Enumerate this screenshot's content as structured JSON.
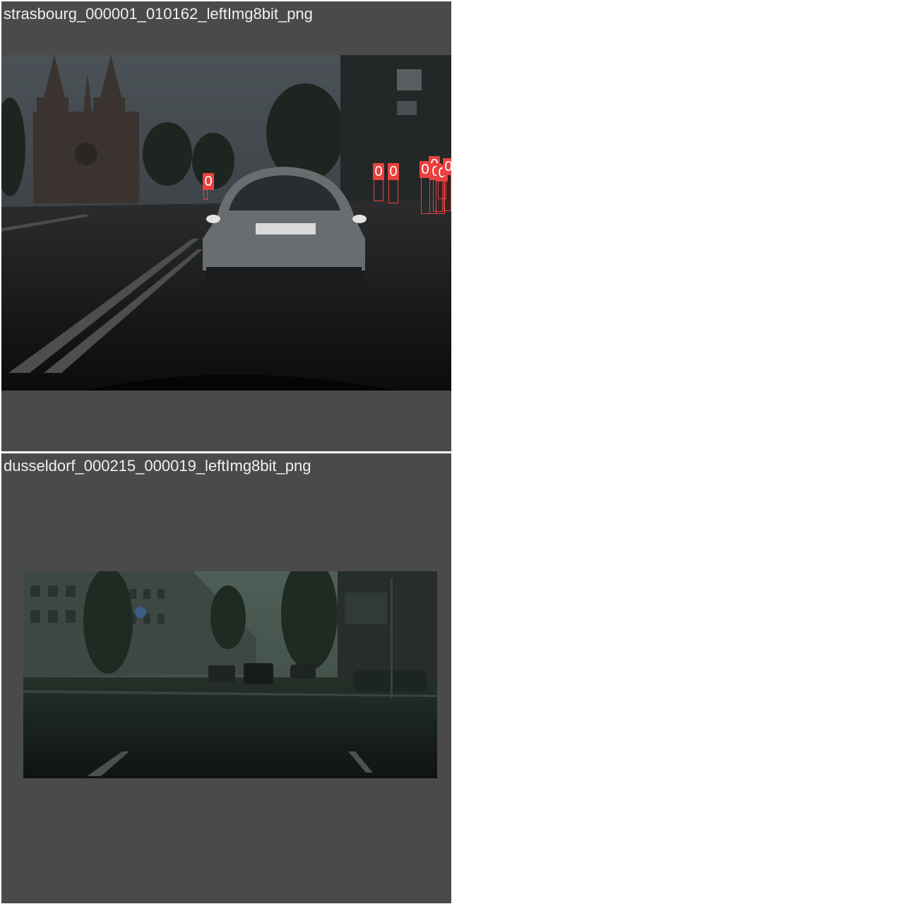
{
  "panels": [
    {
      "title": "strasbourg_000001_010162_leftImg8bit_png",
      "detections": [
        {
          "label": "0"
        },
        {
          "label": "0"
        },
        {
          "label": "0"
        },
        {
          "label": "0"
        },
        {
          "label": "0"
        },
        {
          "label": "0"
        },
        {
          "label": "0"
        },
        {
          "label": "0"
        }
      ]
    },
    {
      "title": "dusseldorf_000215_000019_leftImg8bit_png",
      "detections": []
    }
  ],
  "colors": {
    "panel_background": "#4a4a4a",
    "box": "#e8413e",
    "title_text": "#f0f0f0"
  }
}
